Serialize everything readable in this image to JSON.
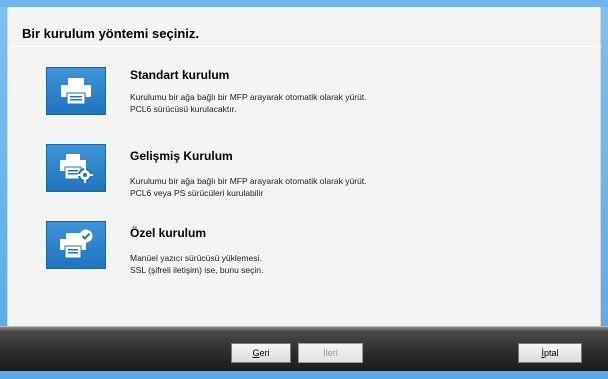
{
  "heading": "Bir kurulum yöntemi seçiniz.",
  "options": [
    {
      "title": "Standart kurulum",
      "desc_line1": "Kurulumu bir ağa bağlı bir MFP arayarak otomatik olarak yürüt.",
      "desc_line2": "PCL6 sürücüsü kurulacaktır.",
      "icon": "printer-icon"
    },
    {
      "title": "Gelişmiş Kurulum",
      "desc_line1": "Kurulumu bir ağa bağlı bir MFP arayarak otomatik olarak yürüt.",
      "desc_line2": "PCL6 veya PS sürücüleri kurulabilir",
      "icon": "printer-gear-icon"
    },
    {
      "title": "Özel kurulum",
      "desc_line1": "Manüel yazıcı sürücüsü yüklemesi.",
      "desc_line2": "SSL (şifreli iletişim) ise, bunu seçin.",
      "icon": "printer-check-icon"
    }
  ],
  "buttons": {
    "back_first": "G",
    "back_rest": "eri",
    "next_first": "İ",
    "next_rest": "leri",
    "cancel_first": "İ",
    "cancel_rest": "ptal"
  },
  "colors": {
    "accent": "#2a84cf",
    "frame": "#5aa9e6"
  }
}
